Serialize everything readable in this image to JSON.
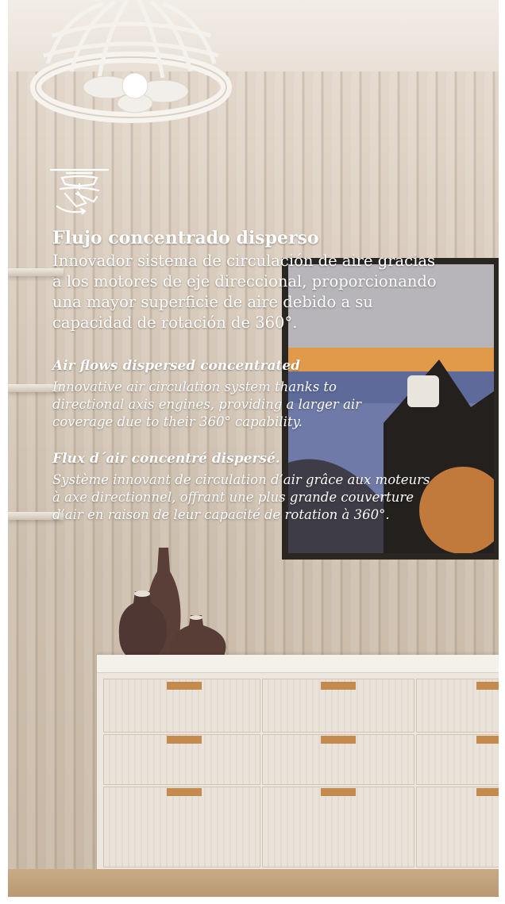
{
  "heading": {
    "es": "Flujo concentrado disperso",
    "en": "Air flows dispersed concentrated",
    "fr": "Flux d´air concentré dispersé."
  },
  "body": {
    "es": "Innovador sistema de circulación de aire gracias a los motores de eje direccional, proporcionando una mayor superficie de aire debido a su capacidad de rotación de 360°.",
    "en": "Innovative air circulation system thanks to directional axis engines, providing a larger air coverage due to their 360° capability.",
    "fr": "Système innovant de circulation d’air grâce aux moteurs à axe directionnel, offrant une plus grande couverture d’air en raison de leur capacité de rotation à 360°."
  },
  "icons": {
    "feature": "rotating-fan-icon"
  },
  "colors": {
    "text": "#ffffff",
    "handle": "#c48a4e"
  }
}
